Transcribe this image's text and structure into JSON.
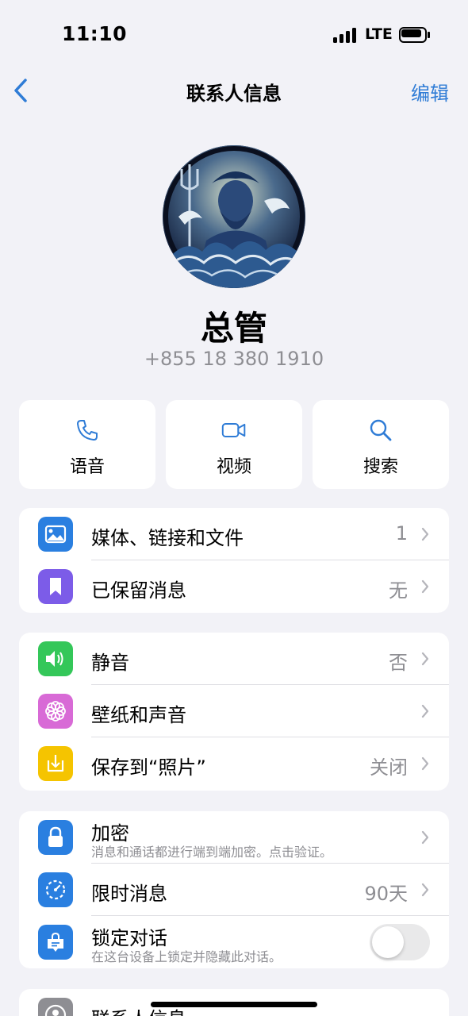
{
  "status": {
    "time": "11:10",
    "network": "LTE",
    "signal_bars": 4,
    "battery_level": 0.85
  },
  "nav": {
    "title": "联系人信息",
    "edit_label": "编辑",
    "back_icon": "chevron-left-icon"
  },
  "profile": {
    "name": "总管",
    "phone": "+855 18 380 1910"
  },
  "actions": [
    {
      "label": "语音",
      "icon": "phone-icon"
    },
    {
      "label": "视频",
      "icon": "video-icon"
    },
    {
      "label": "搜索",
      "icon": "search-icon"
    }
  ],
  "section1": [
    {
      "label": "媒体、链接和文件",
      "value": "1",
      "icon": "photo-icon",
      "color": "#2a7fe0"
    },
    {
      "label": "已保留消息",
      "value": "无",
      "icon": "bookmark-icon",
      "color": "#7c5ce8"
    }
  ],
  "section2": [
    {
      "label": "静音",
      "value": "否",
      "icon": "speaker-icon",
      "color": "#34c759"
    },
    {
      "label": "壁纸和声音",
      "value": "",
      "icon": "flower-icon",
      "color": "#d86ad6"
    },
    {
      "label": "保存到“照片”",
      "value": "关闭",
      "icon": "download-icon",
      "color": "#f5c400"
    }
  ],
  "section3": [
    {
      "label": "加密",
      "sub": "消息和通话都进行端到端加密。点击验证。",
      "icon": "lock-icon",
      "color": "#2a7fe0"
    },
    {
      "label": "限时消息",
      "value": "90天",
      "icon": "timer-icon",
      "color": "#2a7fe0"
    },
    {
      "label": "锁定对话",
      "sub": "在这台设备上锁定并隐藏此对话。",
      "icon": "chat-lock-icon",
      "color": "#2a7fe0",
      "toggle_on": false
    }
  ],
  "section4": [
    {
      "label": "联系人信息",
      "icon": "contact-icon",
      "color": "#8e8e93"
    }
  ],
  "colors": {
    "accent": "#2f7cd6",
    "background": "#f2f2f7",
    "secondary_text": "#8e8e93"
  }
}
